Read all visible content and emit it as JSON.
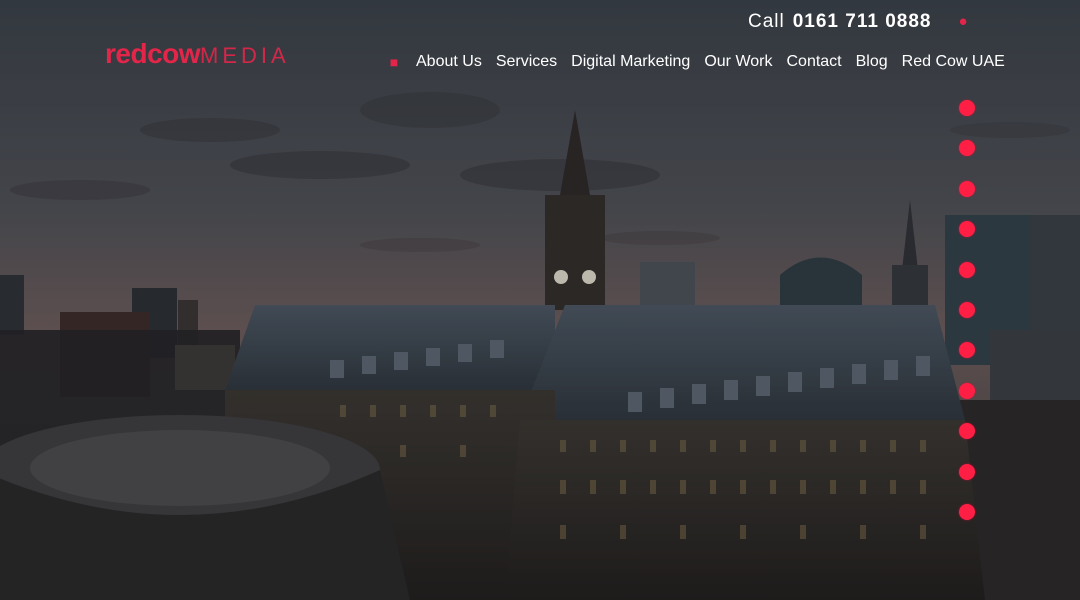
{
  "header": {
    "call_label": "Call",
    "call_number": "0161 711 0888",
    "header_icon": "search-icon"
  },
  "logo": {
    "part1": "redcow",
    "part2": "MEDIA"
  },
  "nav": {
    "menu_icon": "home-icon",
    "items": [
      {
        "label": "About Us"
      },
      {
        "label": "Services"
      },
      {
        "label": "Digital Marketing"
      },
      {
        "label": "Our Work"
      },
      {
        "label": "Contact"
      },
      {
        "label": "Blog"
      },
      {
        "label": "Red Cow UAE"
      }
    ]
  },
  "slider": {
    "dot_count": 11,
    "dot_color": "#ff1f44"
  },
  "colors": {
    "brand": "#e4254a",
    "text": "#ffffff"
  }
}
